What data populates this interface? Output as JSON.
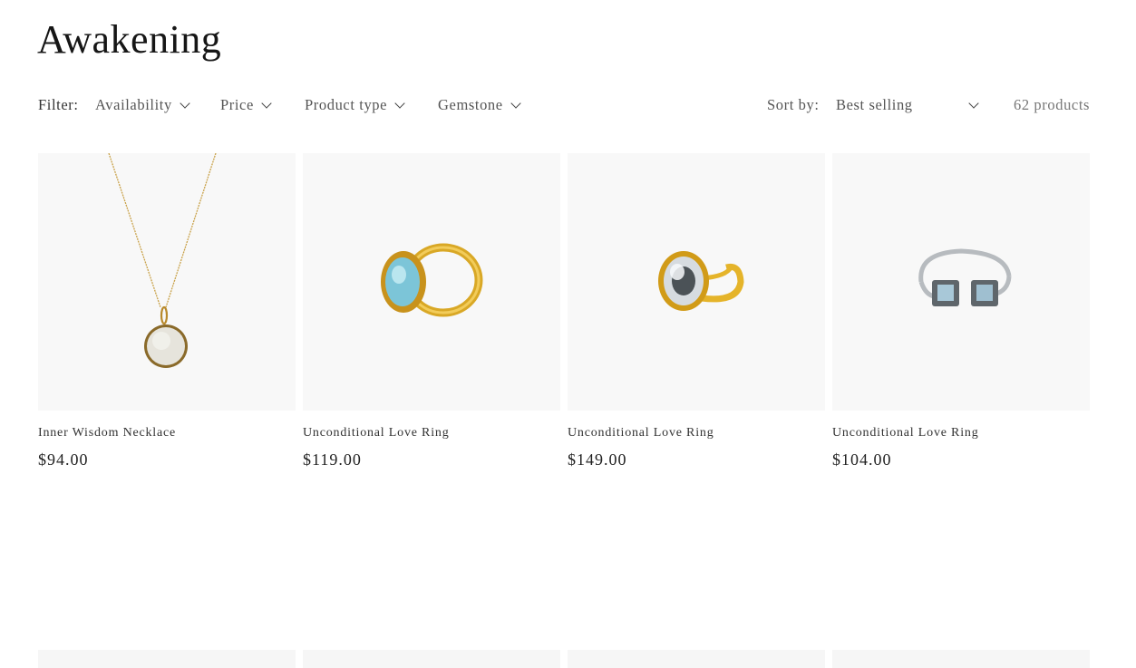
{
  "collection": {
    "title": "Awakening"
  },
  "filters": {
    "label": "Filter:",
    "options": [
      "Availability",
      "Price",
      "Product type",
      "Gemstone"
    ]
  },
  "sort": {
    "label": "Sort by:",
    "selected": "Best selling"
  },
  "product_count": "62 products",
  "products": [
    {
      "title": "Inner Wisdom Necklace",
      "price": "$94.00",
      "image": "necklace-pendant"
    },
    {
      "title": "Unconditional Love Ring",
      "price": "$119.00",
      "image": "gold-ring-aqua-stone"
    },
    {
      "title": "Unconditional Love Ring",
      "price": "$149.00",
      "image": "gold-ring-clear-stone"
    },
    {
      "title": "Unconditional Love Ring",
      "price": "$104.00",
      "image": "silver-open-ring-square-stones"
    }
  ],
  "colors": {
    "image_bg": "#f8f8f8",
    "gold": "#d4a21f",
    "silver": "#b8bcc0",
    "aqua": "#7fc7d6"
  }
}
